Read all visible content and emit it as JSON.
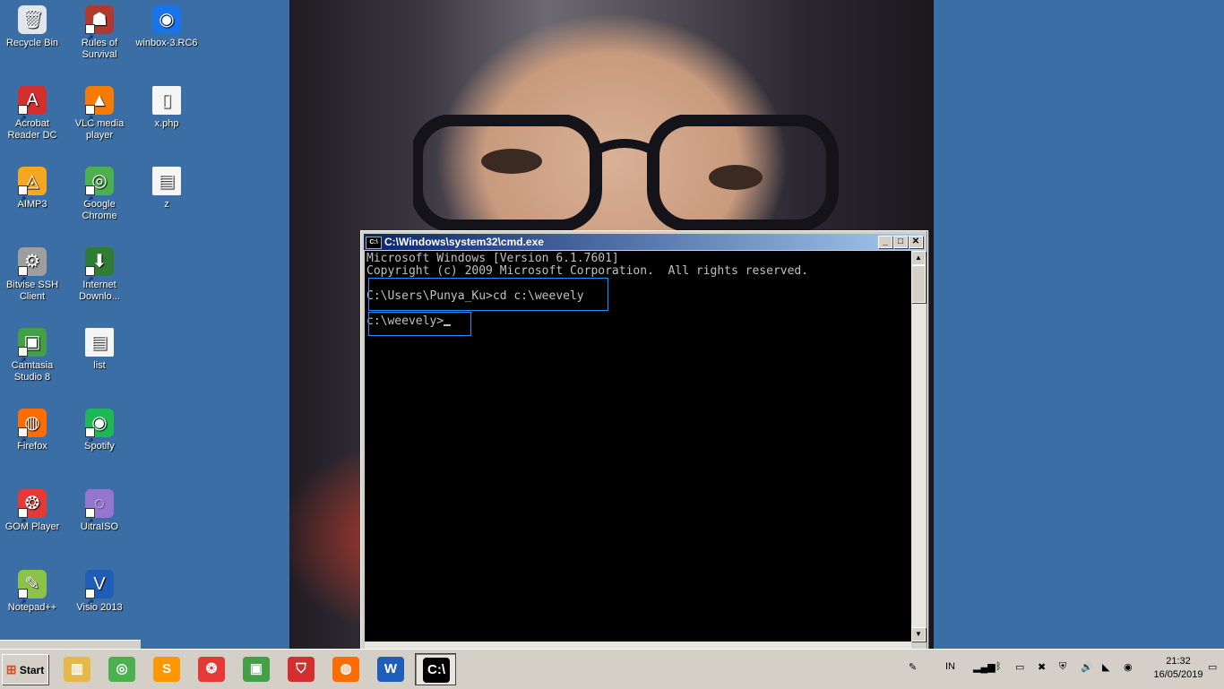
{
  "desktop": {
    "icons": [
      {
        "label": "Recycle Bin",
        "icon": "recycle-bin-icon"
      },
      {
        "label": "Rules of Survival",
        "icon": "rules-of-survival-icon"
      },
      {
        "label": "winbox-3.RC6",
        "icon": "winbox-icon"
      },
      {
        "label": "Acrobat Reader DC",
        "icon": "acrobat-icon"
      },
      {
        "label": "VLC media player",
        "icon": "vlc-icon"
      },
      {
        "label": "x.php",
        "icon": "file-icon"
      },
      {
        "label": "AIMP3",
        "icon": "aimp-icon"
      },
      {
        "label": "Google Chrome",
        "icon": "chrome-icon"
      },
      {
        "label": "z",
        "icon": "text-file-icon"
      },
      {
        "label": "Bitvise SSH Client",
        "icon": "bitvise-icon"
      },
      {
        "label": "Internet Downlo...",
        "icon": "idm-icon"
      },
      {
        "label": "Camtasia Studio 8",
        "icon": "camtasia-icon"
      },
      {
        "label": "list",
        "icon": "text-file-icon"
      },
      {
        "label": "Firefox",
        "icon": "firefox-icon"
      },
      {
        "label": "Spotify",
        "icon": "spotify-icon"
      },
      {
        "label": "GOM Player",
        "icon": "gom-icon"
      },
      {
        "label": "UltraISO",
        "icon": "ultraiso-icon"
      },
      {
        "label": "Notepad++",
        "icon": "notepadpp-icon"
      },
      {
        "label": "Visio 2013",
        "icon": "visio-icon"
      }
    ]
  },
  "cmd": {
    "title": "C:\\Windows\\system32\\cmd.exe",
    "icon_text": "C:\\",
    "lines": [
      "Microsoft Windows [Version 6.1.7601]",
      "Copyright (c) 2009 Microsoft Corporation.  All rights reserved.",
      "",
      "C:\\Users\\Punya_Ku>cd c:\\weevely",
      "",
      "c:\\weevely>"
    ],
    "minimize": "_",
    "maximize": "□",
    "close": "✕"
  },
  "taskbar": {
    "start_label": "Start",
    "pinned": [
      {
        "name": "explorer",
        "icon": "folder-icon"
      },
      {
        "name": "chrome",
        "icon": "chrome-icon"
      },
      {
        "name": "sublime",
        "icon": "sublime-icon"
      },
      {
        "name": "gom",
        "icon": "gom-icon"
      },
      {
        "name": "camtasia",
        "icon": "camtasia-icon"
      },
      {
        "name": "antivirus",
        "icon": "shield-icon"
      },
      {
        "name": "firefox",
        "icon": "firefox-icon"
      },
      {
        "name": "word",
        "icon": "word-icon"
      },
      {
        "name": "cmd",
        "icon": "cmd-icon"
      }
    ],
    "language": "IN",
    "time": "21:32",
    "date": "16/05/2019"
  }
}
